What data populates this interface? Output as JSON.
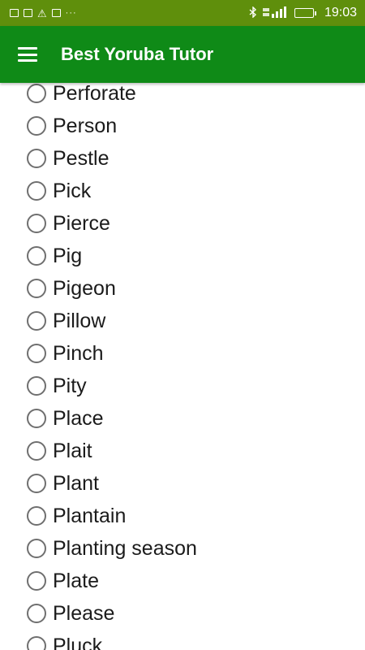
{
  "status_bar": {
    "time": "19:03",
    "left_icons": [
      "image-icon",
      "sim-icon",
      "warning-icon",
      "gallery-icon",
      "more-dots-icon"
    ],
    "right_icons": [
      "bluetooth-icon",
      "signal-icon",
      "battery-icon"
    ]
  },
  "app_bar": {
    "title": "Best Yoruba Tutor",
    "color": "#0f8a17"
  },
  "word_list": [
    "Perforate",
    "Person",
    "Pestle",
    "Pick",
    "Pierce",
    "Pig",
    "Pigeon",
    "Pillow",
    "Pinch",
    "Pity",
    "Place",
    "Plait",
    "Plant",
    "Plantain",
    "Planting season",
    "Plate",
    "Please",
    "Pluck"
  ]
}
